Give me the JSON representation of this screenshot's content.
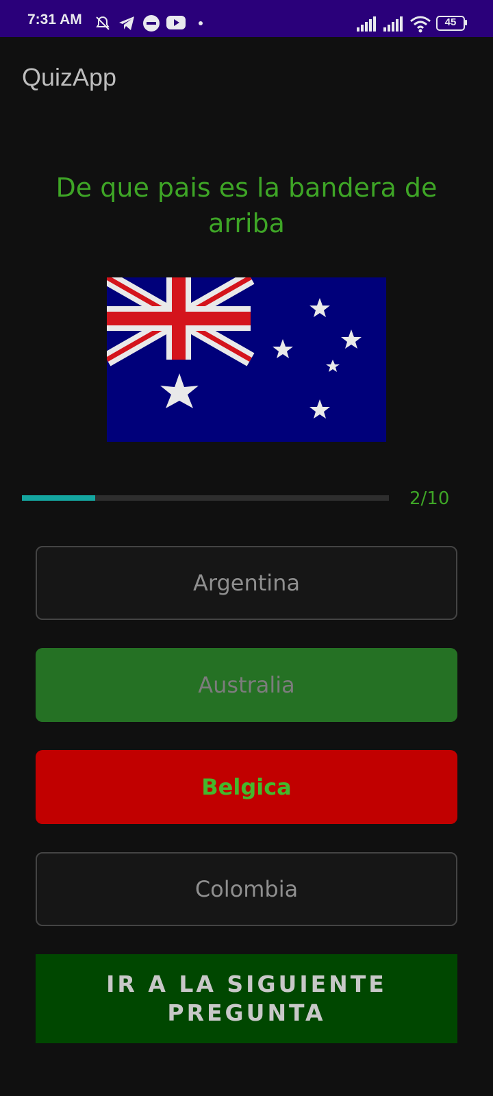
{
  "status_bar": {
    "time": "7:31 AM",
    "battery": "45",
    "icons": [
      "mute-alarm-icon",
      "telegram-icon",
      "do-not-disturb-icon",
      "youtube-icon",
      "dot-icon",
      "signal-icon",
      "signal-icon",
      "wifi-icon",
      "battery-icon"
    ]
  },
  "app_bar": {
    "title": "QuizApp"
  },
  "question": {
    "text": "De que pais es la bandera de arriba"
  },
  "flag": {
    "icon": "australia-flag-image"
  },
  "progress": {
    "value": 2,
    "max": 10,
    "label": "2/10"
  },
  "options": [
    {
      "label": "Argentina",
      "state": "default"
    },
    {
      "label": "Australia",
      "state": "correct"
    },
    {
      "label": "Belgica",
      "state": "wrong"
    },
    {
      "label": "Colombia",
      "state": "default"
    }
  ],
  "next_button": {
    "label": "IR A LA SIGUIENTE PREGUNTA"
  },
  "colors": {
    "status_bar": "#2a007a",
    "background": "#101010",
    "question_text": "#3ea526",
    "progress_fill": "#14a6a0",
    "correct": "#257124",
    "wrong": "#c10000",
    "next_button": "#004700"
  }
}
